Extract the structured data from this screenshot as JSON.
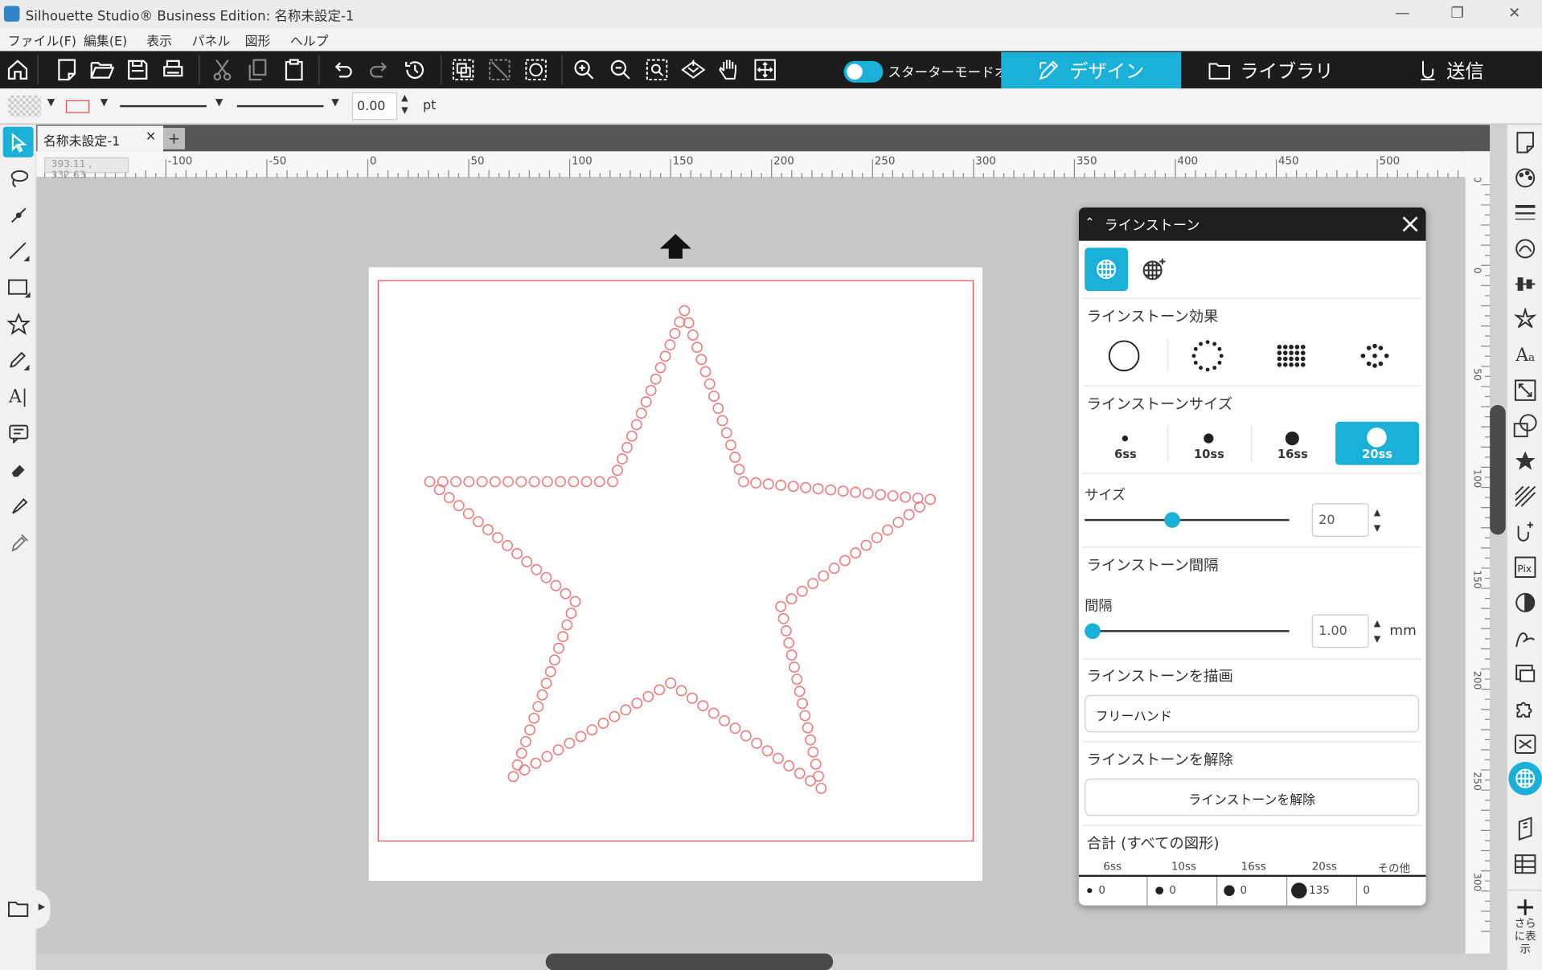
{
  "window": {
    "title": "Silhouette Studio® Business Edition: 名称未設定-1"
  },
  "menu": [
    "ファイル(F)",
    "編集(E)",
    "表示",
    "パネル",
    "図形",
    "ヘルプ"
  ],
  "toolbar": {
    "starter_mode_label": "スターターモードオフ",
    "tabs": {
      "design": "デザイン",
      "library": "ライブラリ",
      "send": "送信"
    }
  },
  "linebar": {
    "line_width": "0.00",
    "unit": "pt"
  },
  "document": {
    "tab_label": "名称未設定-1",
    "add_tab": "+",
    "coords": "393.11 , 332.63"
  },
  "ruler": {
    "h_ticks": [
      "-100",
      "-50",
      "0",
      "50",
      "100",
      "150",
      "200",
      "250",
      "300",
      "350",
      "400",
      "450",
      "500"
    ],
    "v_ticks": [
      "-50",
      "0",
      "50",
      "100",
      "150",
      "200",
      "250",
      "300"
    ]
  },
  "panel": {
    "title": "ラインストーン",
    "effect_title": "ラインストーン効果",
    "size_title": "ラインストーンサイズ",
    "sizes": [
      "6ss",
      "10ss",
      "16ss",
      "20ss"
    ],
    "selected_size": "20ss",
    "size_label": "サイズ",
    "size_value": "20",
    "spacing_title": "ラインストーン間隔",
    "spacing_label": "間隔",
    "spacing_value": "1.00",
    "spacing_unit": "mm",
    "draw_title": "ラインストーンを描画",
    "draw_option": "フリーハンド",
    "release_title": "ラインストーンを解除",
    "release_button": "ラインストーンを解除",
    "totals_title": "合計 (すべての図形)",
    "totals_headers": [
      "6ss",
      "10ss",
      "16ss",
      "20ss",
      "その他"
    ],
    "totals_values": [
      "0",
      "0",
      "0",
      "135",
      "0"
    ]
  },
  "right_tools": {
    "more_label": "さらに表示"
  },
  "colors": {
    "accent": "#1ab0d8",
    "rhinestone": "#f07878",
    "cut_line": "#e94f4f"
  }
}
